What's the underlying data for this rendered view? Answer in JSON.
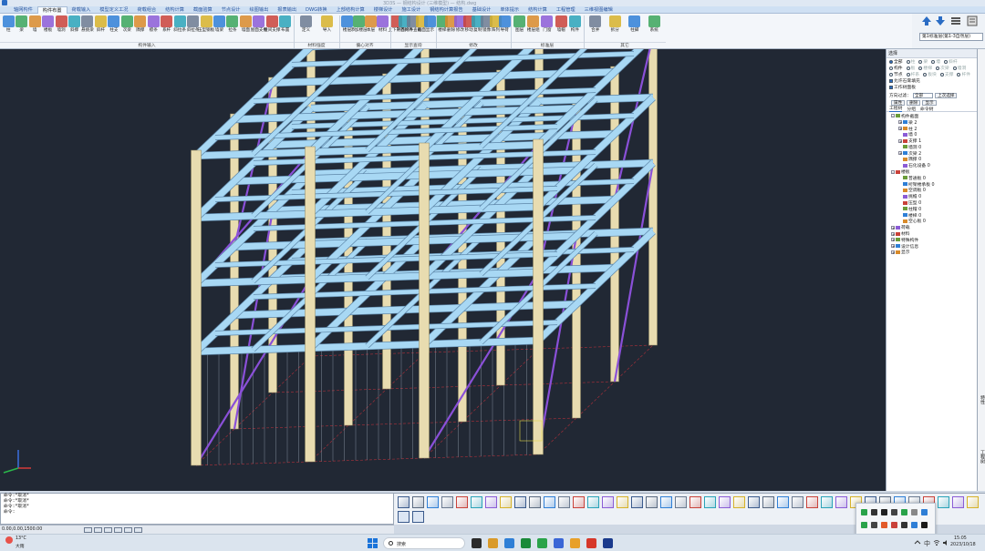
{
  "app": {
    "title": "3D3S — 钢结构设计 (三维模型) — 结构.dwg"
  },
  "tabs": [
    "轴网构件",
    "构件布置",
    "荷载输入",
    "模型定义工况",
    "荷载组合",
    "结构计算",
    "截面验算",
    "节点设计",
    "绘图输出",
    "报表输出",
    "DWG转换",
    "上部结构计算",
    "楼梯设计",
    "施工设计",
    "钢结构计算报告",
    "基础设计",
    "单体提示",
    "结构计算",
    "工程管理",
    "三维视图编辑"
  ],
  "active_tab_index": 1,
  "ribbon": {
    "buttons": [
      "柱",
      "梁",
      "墙",
      "楼板",
      "墙洞",
      "斜撑",
      "悬挑梁",
      "斜杆",
      "柱支",
      "次梁",
      "隅撑",
      "檩条",
      "系杆",
      "斜拉条",
      "斜拉条",
      "压型钢板",
      "墙梁",
      "拉条",
      "墙面",
      "屋面支撑",
      "柱间支撑",
      "布置",
      "定义",
      "导入",
      "楼层",
      "添加楼层",
      "本层",
      "材料",
      "上下对齐",
      "平面对齐",
      "构件查询",
      "截面",
      "显示",
      "楼梯",
      "删除",
      "修改",
      "移动",
      "复制",
      "镜像",
      "阵列",
      "导荷",
      "图层",
      "楼层组",
      "门窗",
      "墙帽",
      "构件",
      "合并",
      "拆分",
      "柱脚",
      "系统"
    ],
    "groups": [
      "构件输入",
      "材料强度",
      "偏心对齐",
      "显示查询",
      "修改",
      "标准层",
      "其它"
    ]
  },
  "floor_select": "第1标准层(第1-3自然层)",
  "panel": {
    "title": "选择",
    "options_row1": [
      "全部",
      "柱",
      "梁",
      "墙",
      "斜杆"
    ],
    "options_row2": [
      "构件",
      "板",
      "楼梯",
      "次梁",
      "墙洞"
    ],
    "options_row3": [
      "节点",
      "杆系",
      "板块",
      "支撑",
      "杆件"
    ],
    "option_flags": [
      "允许石膏填充",
      "工作树面板"
    ],
    "filter_label": "方向过滤：",
    "filter_value": "全部",
    "filter_button": "上次选择",
    "tool_labels": [
      "属性",
      "删除",
      "显示"
    ],
    "tabs": [
      "工程树",
      "分组",
      "命令树"
    ],
    "tree": [
      {
        "label": "构件截面",
        "level": 0,
        "expand": "-"
      },
      {
        "label": "梁 2",
        "level": 1,
        "expand": "+"
      },
      {
        "label": "柱 2",
        "level": 1,
        "expand": "+"
      },
      {
        "label": "墙 0",
        "level": 1,
        "expand": ""
      },
      {
        "label": "支撑 1",
        "level": 1,
        "expand": "+"
      },
      {
        "label": "墙洞 0",
        "level": 1,
        "expand": ""
      },
      {
        "label": "次梁 2",
        "level": 1,
        "expand": "+"
      },
      {
        "label": "隅撑 0",
        "level": 1,
        "expand": ""
      },
      {
        "label": "石化设备 0",
        "level": 1,
        "expand": ""
      },
      {
        "label": "楼板",
        "level": 0,
        "expand": "-"
      },
      {
        "label": "普通板 0",
        "level": 1,
        "expand": ""
      },
      {
        "label": "桁架楼承板 0",
        "level": 1,
        "expand": ""
      },
      {
        "label": "空调板 0",
        "level": 1,
        "expand": ""
      },
      {
        "label": "挑檐 0",
        "level": 1,
        "expand": ""
      },
      {
        "label": "压型 0",
        "level": 1,
        "expand": ""
      },
      {
        "label": "柱帽 0",
        "level": 1,
        "expand": ""
      },
      {
        "label": "楼梯 0",
        "level": 1,
        "expand": ""
      },
      {
        "label": "空心板 0",
        "level": 1,
        "expand": ""
      },
      {
        "label": "荷载",
        "level": 0,
        "expand": "+"
      },
      {
        "label": "材料",
        "level": 0,
        "expand": "+"
      },
      {
        "label": "特殊构件",
        "level": 0,
        "expand": "+"
      },
      {
        "label": "设计信息",
        "level": 0,
        "expand": "+"
      },
      {
        "label": "显示",
        "level": 0,
        "expand": "+"
      }
    ],
    "side_tabs": [
      "特性",
      "工程树"
    ]
  },
  "command": {
    "history": [
      "命令:*取消*",
      "命令:*取消*",
      "命令:*取消*"
    ],
    "prompt": "命令:",
    "input_value": ""
  },
  "status": {
    "coords": "0.00,0.00,1500.00"
  },
  "taskbar": {
    "weather_temp": "13°C",
    "weather_desc": "大雨",
    "search_placeholder": "搜索",
    "time": "15:05",
    "date": "2023/10/18"
  },
  "colors": {
    "viewport_bg": "#212834",
    "beam": "#a8d8f4",
    "column": "#e8dcb0",
    "brace": "#8a50d8",
    "grid_red": "#b0303a",
    "ribbon_bg": "#f3f6fa",
    "accent": "#2a6cc4"
  }
}
